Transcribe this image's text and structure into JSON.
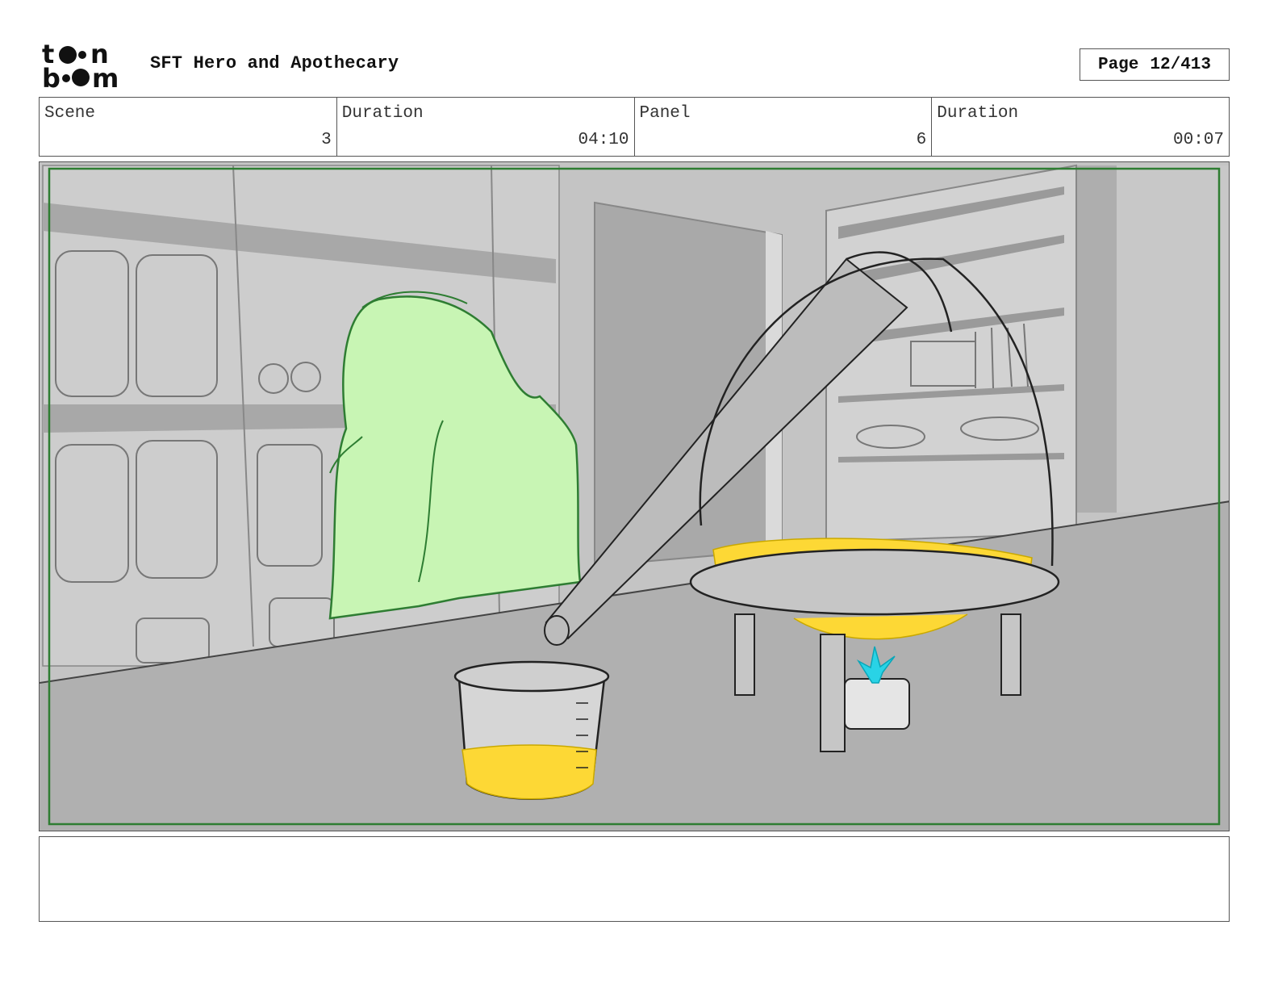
{
  "header": {
    "logo_text": "toon boom",
    "project_title": "SFT Hero and Apothecary",
    "page_label": "Page",
    "page_value": "12/413"
  },
  "info": {
    "scene_label": "Scene",
    "scene_value": "3",
    "scene_duration_label": "Duration",
    "scene_duration_value": "04:10",
    "panel_label": "Panel",
    "panel_value": "6",
    "panel_duration_label": "Duration",
    "panel_duration_value": "00:07"
  },
  "notes": {
    "text": ""
  },
  "colors": {
    "safe_frame": "#2e7d32",
    "character": "#c8f5b4",
    "liquid": "#fdd835",
    "flame": "#29d3e6"
  }
}
